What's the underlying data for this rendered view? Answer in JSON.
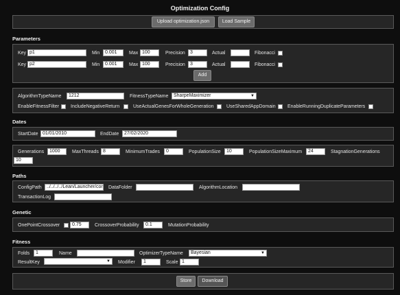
{
  "title": "Optimization Config",
  "top_buttons": {
    "upload": "Upload optimization.json",
    "load_sample": "Load Sample"
  },
  "parameters": {
    "heading": "Parameters",
    "labels": {
      "key": "Key",
      "min": "Min",
      "max": "Max",
      "precision": "Precision",
      "actual": "Actual",
      "fibonacci": "Fibonacci"
    },
    "rows": [
      {
        "key": "p1",
        "min": "0.001",
        "max": "100",
        "precision": "3",
        "actual": ""
      },
      {
        "key": "p2",
        "min": "0.001",
        "max": "100",
        "precision": "3",
        "actual": ""
      }
    ],
    "add_label": "Add"
  },
  "algorithm": {
    "algorithm_type_label": "AlgorithmTypeName",
    "algorithm_type_value": "1212",
    "fitness_type_label": "FitnessTypeName",
    "fitness_type_value": "SharpeMaximizer",
    "checks": {
      "enable_fitness_filter": "EnableFitnessFilter",
      "include_negative_return": "IncludeNegativeReturn",
      "use_actual_genes": "UseActualGenesForWholeGeneration",
      "use_shared_app_domain": "UseSharedAppDomain",
      "enable_running_duplicate": "EnableRunningDuplicateParameters"
    }
  },
  "dates": {
    "heading": "Dates",
    "start_label": "StartDate",
    "start_value": "01/01/2010",
    "end_label": "EndDate",
    "end_value": "27/02/2020"
  },
  "generation": {
    "generations_label": "Generations",
    "generations_value": "1000",
    "max_threads_label": "MaxThreads",
    "max_threads_value": "8",
    "min_trades_label": "MinimumTrades",
    "min_trades_value": "0",
    "pop_size_label": "PopulationSize",
    "pop_size_value": "10",
    "pop_size_max_label": "PopulationSizeMaximum",
    "pop_size_max_value": "24",
    "stagnation_label": "StagnationGenerations",
    "stagnation_value": "10"
  },
  "paths": {
    "heading": "Paths",
    "config_path_label": "ConfigPath",
    "config_path_value": "../../../../Lean/Launcher/config.json",
    "data_folder_label": "DataFolder",
    "data_folder_value": "",
    "algorithm_location_label": "AlgorithmLocation",
    "algorithm_location_value": "",
    "transaction_log_label": "TransactionLog",
    "transaction_log_value": ""
  },
  "genetic": {
    "heading": "Genetic",
    "one_point_label": "OnePointCrossover",
    "crossover_prob_value": "0.75",
    "crossover_prob_label": "CrossoverProbability",
    "mutation_prob_value": "0.1",
    "mutation_prob_label": "MutationProbability"
  },
  "fitness": {
    "heading": "Fitness",
    "folds_label": "Folds",
    "folds_value": "1",
    "name_label": "Name",
    "name_value": "",
    "optimizer_type_label": "OptimizerTypeName",
    "optimizer_type_value": "Bayesian",
    "result_key_label": "ResultKey",
    "result_key_value": "",
    "modifier_label": "Modifier",
    "modifier_value": "1",
    "scale_label": "Scale",
    "scale_value": "1"
  },
  "bottom_buttons": {
    "store": "Store",
    "download": "Download"
  }
}
